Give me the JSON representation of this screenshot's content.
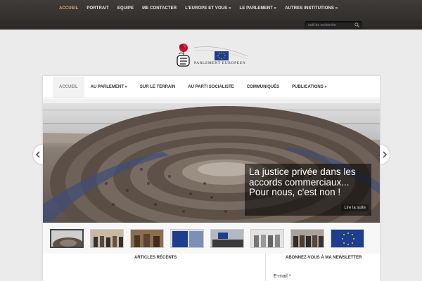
{
  "top_nav": {
    "items": [
      {
        "label": "ACCUEIL",
        "active": true
      },
      {
        "label": "PORTRAIT"
      },
      {
        "label": "EQUIPE"
      },
      {
        "label": "ME CONTACTER"
      },
      {
        "label": "L'EUROPE ET VOUS »"
      },
      {
        "label": "LE PARLEMENT »"
      },
      {
        "label": "AUTRES INSTITUTIONS »"
      }
    ]
  },
  "search": {
    "placeholder": "outil de recherche",
    "icon": "search-icon"
  },
  "logo": {
    "text": "PARLEMENT EUROPEEN"
  },
  "main_nav": {
    "items": [
      {
        "label": "ACCUEIL",
        "active": true
      },
      {
        "label": "AU PARLEMENT »"
      },
      {
        "label": "SUR LE TERRAIN"
      },
      {
        "label": "AU PARTI SOCIALISTE"
      },
      {
        "label": "COMMUNIQUÉS"
      },
      {
        "label": "PUBLICATIONS »"
      }
    ]
  },
  "slider": {
    "caption": "La justice privée dans les accords commerciaux... Pour nous, c'est non !",
    "read_more": "Lire la suite"
  },
  "sections": {
    "recent_articles": "ARTICLES RÉCENTS",
    "newsletter": "ABONNEZ-VOUS À MA NEWSLETTER",
    "email_label": "E-mail",
    "required_mark": "*"
  },
  "colors": {
    "topbar": "#2f2d2b",
    "active_top": "#e6a85c",
    "eu_blue": "#1d3d8f",
    "eu_star": "#f2d100",
    "rose": "#c8102e"
  }
}
